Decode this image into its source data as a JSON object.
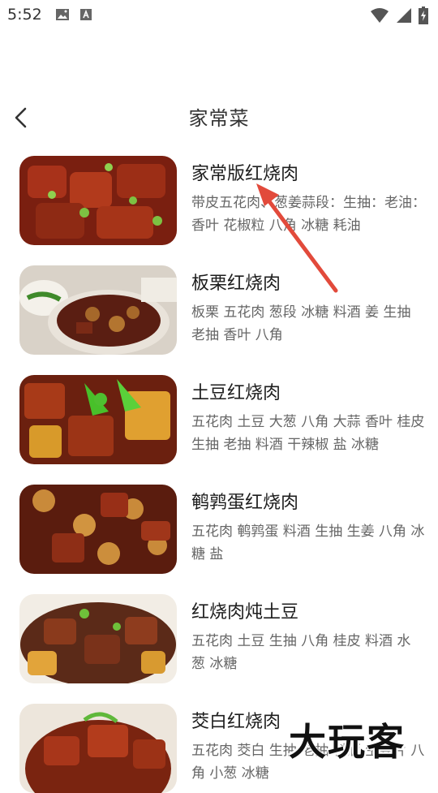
{
  "status_bar": {
    "time": "5:52",
    "left_icons": [
      "image-icon",
      "a-badge-icon"
    ],
    "right_icons": [
      "wifi-icon",
      "signal-icon",
      "battery-icon"
    ]
  },
  "header": {
    "title": "家常菜"
  },
  "recipes": [
    {
      "name": "家常版红烧肉",
      "ingredients": "带皮五花肉、葱姜蒜段：生抽：老油：香叶 花椒粒 八角 冰糖 耗油"
    },
    {
      "name": "板栗红烧肉",
      "ingredients": "板栗 五花肉 葱段 冰糖 料酒 姜 生抽 老抽 香叶 八角"
    },
    {
      "name": "土豆红烧肉",
      "ingredients": "五花肉 土豆 大葱 八角 大蒜 香叶 桂皮 生抽 老抽 料酒 干辣椒 盐 冰糖"
    },
    {
      "name": "鹌鹑蛋红烧肉",
      "ingredients": "五花肉 鹌鹑蛋 料酒 生抽 生姜 八角 冰糖 盐"
    },
    {
      "name": "红烧肉炖土豆",
      "ingredients": "五花肉 土豆 生抽 八角 桂皮 料酒 水 葱 冰糖"
    },
    {
      "name": "茭白红烧肉",
      "ingredients": "五花肉 茭白 生抽 老抽 料酒 生姜片 八角 小葱 冰糖"
    }
  ],
  "watermark": "大玩客",
  "colors": {
    "accent_arrow": "#e24a3b",
    "title_text": "#333333",
    "desc_text": "#666666"
  }
}
